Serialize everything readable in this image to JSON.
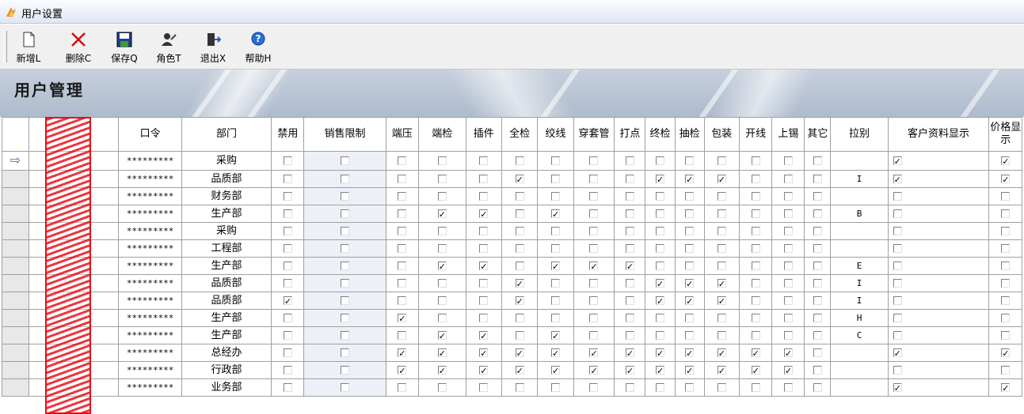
{
  "window": {
    "title": "用户设置"
  },
  "toolbar": {
    "buttons": [
      {
        "label": "新增L",
        "icon": "new-doc-icon"
      },
      {
        "label": "删除C",
        "icon": "delete-x-icon"
      },
      {
        "label": "保存Q",
        "icon": "save-disk-icon"
      },
      {
        "label": "角色T",
        "icon": "role-user-icon"
      },
      {
        "label": "退出X",
        "icon": "exit-door-icon"
      },
      {
        "label": "帮助H",
        "icon": "help-icon"
      }
    ]
  },
  "banner": {
    "heading": "用户管理"
  },
  "grid": {
    "columns": [
      "",
      "",
      "口令",
      "部门",
      "禁用",
      "销售限制",
      "端压",
      "端检",
      "插件",
      "全检",
      "绞线",
      "穿套管",
      "打点",
      "终检",
      "抽检",
      "包装",
      "开线",
      "上锡",
      "其它",
      "拉别",
      "客户资料显示",
      "价格显示"
    ],
    "rows": [
      {
        "pw": "*********",
        "dept": "采购",
        "current": true,
        "flags": [
          0,
          0,
          0,
          0,
          0,
          0,
          0,
          0,
          0,
          0,
          0,
          0,
          0,
          0,
          0
        ],
        "line": "",
        "cust": 1,
        "price": 1
      },
      {
        "pw": "*********",
        "dept": "品质部",
        "flags": [
          0,
          0,
          0,
          0,
          0,
          1,
          0,
          0,
          0,
          1,
          1,
          1,
          0,
          0,
          0
        ],
        "line": "I",
        "cust": 1,
        "price": 1
      },
      {
        "pw": "*********",
        "dept": "财务部",
        "flags": [
          0,
          0,
          0,
          0,
          0,
          0,
          0,
          0,
          0,
          0,
          0,
          0,
          0,
          0,
          0
        ],
        "line": "",
        "cust": 0,
        "price": 0
      },
      {
        "pw": "*********",
        "dept": "生产部",
        "flags": [
          0,
          0,
          0,
          1,
          1,
          0,
          1,
          0,
          0,
          0,
          0,
          0,
          0,
          0,
          0
        ],
        "line": "B",
        "cust": 0,
        "price": 0
      },
      {
        "pw": "*********",
        "dept": "采购",
        "flags": [
          0,
          0,
          0,
          0,
          0,
          0,
          0,
          0,
          0,
          0,
          0,
          0,
          0,
          0,
          0
        ],
        "line": "",
        "cust": 0,
        "price": 0
      },
      {
        "pw": "*********",
        "dept": "工程部",
        "flags": [
          0,
          0,
          0,
          0,
          0,
          0,
          0,
          0,
          0,
          0,
          0,
          0,
          0,
          0,
          0
        ],
        "line": "",
        "cust": 0,
        "price": 0
      },
      {
        "pw": "*********",
        "dept": "生产部",
        "flags": [
          0,
          0,
          0,
          1,
          1,
          0,
          1,
          1,
          1,
          0,
          0,
          0,
          0,
          0,
          0
        ],
        "line": "E",
        "cust": 0,
        "price": 0
      },
      {
        "pw": "*********",
        "dept": "品质部",
        "flags": [
          0,
          0,
          0,
          0,
          0,
          1,
          0,
          0,
          0,
          1,
          1,
          1,
          0,
          0,
          0
        ],
        "line": "I",
        "cust": 0,
        "price": 0
      },
      {
        "pw": "*********",
        "dept": "品质部",
        "flags": [
          1,
          0,
          0,
          0,
          0,
          1,
          0,
          0,
          0,
          1,
          1,
          1,
          0,
          0,
          0
        ],
        "line": "I",
        "cust": 0,
        "price": 0
      },
      {
        "pw": "*********",
        "dept": "生产部",
        "flags": [
          0,
          0,
          1,
          0,
          0,
          0,
          0,
          0,
          0,
          0,
          0,
          0,
          0,
          0,
          0
        ],
        "line": "H",
        "cust": 0,
        "price": 0
      },
      {
        "pw": "*********",
        "dept": "生产部",
        "flags": [
          0,
          0,
          0,
          1,
          1,
          0,
          1,
          0,
          0,
          0,
          0,
          0,
          0,
          0,
          0
        ],
        "line": "C",
        "cust": 0,
        "price": 0
      },
      {
        "pw": "*********",
        "dept": "总经办",
        "flags": [
          0,
          0,
          1,
          1,
          1,
          1,
          1,
          1,
          1,
          1,
          1,
          1,
          1,
          1,
          0
        ],
        "line": "",
        "cust": 1,
        "price": 1
      },
      {
        "pw": "*********",
        "dept": "行政部",
        "flags": [
          0,
          0,
          1,
          1,
          1,
          1,
          1,
          1,
          1,
          1,
          1,
          1,
          1,
          1,
          0
        ],
        "line": "",
        "cust": 0,
        "price": 0
      },
      {
        "pw": "*********",
        "dept": "业务部",
        "flags": [
          0,
          0,
          0,
          0,
          0,
          0,
          0,
          0,
          0,
          0,
          0,
          0,
          0,
          0,
          0
        ],
        "line": "",
        "cust": 1,
        "price": 1
      }
    ]
  }
}
